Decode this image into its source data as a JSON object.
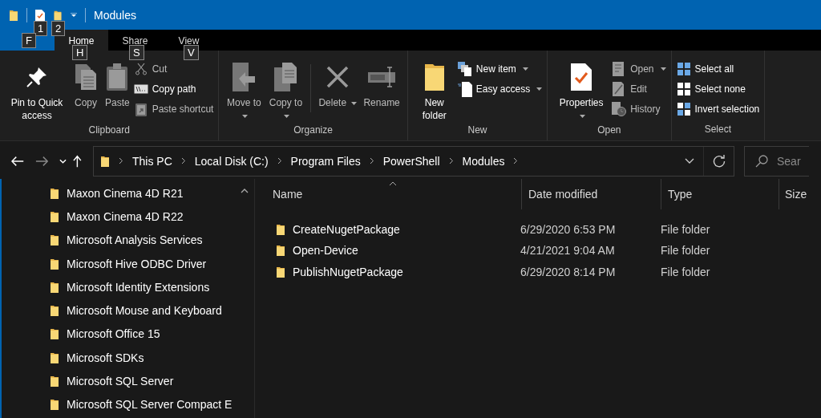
{
  "title_bar": {
    "quick_access": [
      {
        "keytip": "1"
      },
      {
        "keytip": "2"
      }
    ],
    "title": "Modules"
  },
  "ribbon_tabs": {
    "file_keytip": "F",
    "tabs": [
      {
        "label": "Home",
        "keytip": "H",
        "selected": true
      },
      {
        "label": "Share",
        "keytip": "S",
        "selected": false
      },
      {
        "label": "View",
        "keytip": "V",
        "selected": false
      }
    ]
  },
  "ribbon_groups": [
    {
      "label": "Clipboard",
      "large": [
        {
          "label": "Pin to Quick access",
          "disabled": false,
          "dropdown": false
        },
        {
          "label": "Copy",
          "disabled": true,
          "dropdown": false
        },
        {
          "label": "Paste",
          "disabled": true,
          "dropdown": false
        }
      ],
      "small": [
        {
          "label": "Cut",
          "disabled": true,
          "dropdown": false
        },
        {
          "label": "Copy path",
          "disabled": false,
          "dropdown": false
        },
        {
          "label": "Paste shortcut",
          "disabled": true,
          "dropdown": false
        }
      ]
    },
    {
      "label": "Organize",
      "large": [
        {
          "label": "Move to",
          "disabled": true,
          "dropdown": true
        },
        {
          "label": "Copy to",
          "disabled": true,
          "dropdown": true
        },
        {
          "label": "Delete",
          "disabled": true,
          "dropdown": true
        },
        {
          "label": "Rename",
          "disabled": true,
          "dropdown": false
        }
      ]
    },
    {
      "label": "New",
      "large": [
        {
          "label": "New folder",
          "disabled": false,
          "dropdown": false
        }
      ],
      "small": [
        {
          "label": "New item",
          "disabled": false,
          "dropdown": true
        },
        {
          "label": "Easy access",
          "disabled": false,
          "dropdown": true
        }
      ]
    },
    {
      "label": "Open",
      "large": [
        {
          "label": "Properties",
          "disabled": false,
          "dropdown": true
        }
      ],
      "small": [
        {
          "label": "Open",
          "disabled": true,
          "dropdown": true
        },
        {
          "label": "Edit",
          "disabled": true,
          "dropdown": false
        },
        {
          "label": "History",
          "disabled": true,
          "dropdown": false
        }
      ]
    },
    {
      "label": "Select",
      "small": [
        {
          "label": "Select all",
          "disabled": false,
          "dropdown": false
        },
        {
          "label": "Select none",
          "disabled": false,
          "dropdown": false
        },
        {
          "label": "Invert selection",
          "disabled": false,
          "dropdown": false
        }
      ]
    }
  ],
  "address_bar": {
    "path": [
      "This PC",
      "Local Disk (C:)",
      "Program Files",
      "PowerShell",
      "Modules"
    ]
  },
  "search": {
    "placeholder": "Sear"
  },
  "navigation_pane": {
    "items": [
      "Maxon Cinema 4D R21",
      "Maxon Cinema 4D R22",
      "Microsoft Analysis Services",
      "Microsoft Hive ODBC Driver",
      "Microsoft Identity Extensions",
      "Microsoft Mouse and Keyboard",
      "Microsoft Office 15",
      "Microsoft SDKs",
      "Microsoft SQL Server",
      "Microsoft SQL Server Compact E"
    ]
  },
  "file_list": {
    "columns": [
      "Name",
      "Date modified",
      "Type",
      "Size"
    ],
    "rows": [
      {
        "name": "CreateNugetPackage",
        "date_modified": "6/29/2020 6:53 PM",
        "type": "File folder"
      },
      {
        "name": "Open-Device",
        "date_modified": "4/21/2021 9:04 AM",
        "type": "File folder"
      },
      {
        "name": "PublishNugetPackage",
        "date_modified": "6/29/2020 8:14 PM",
        "type": "File folder"
      }
    ]
  }
}
